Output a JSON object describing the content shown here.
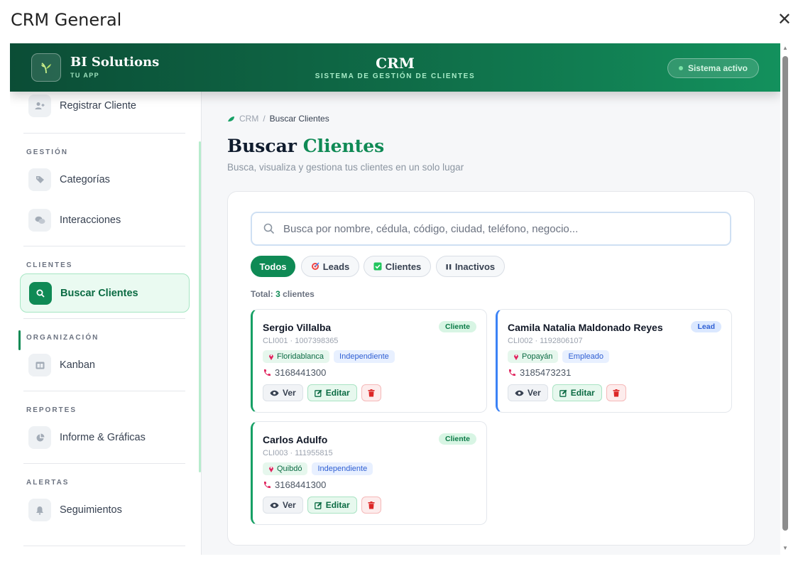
{
  "dialog": {
    "title": "CRM General",
    "close": "✕"
  },
  "header": {
    "brand_name": "BI Solutions",
    "brand_sub": "TU APP",
    "title": "CRM",
    "subtitle": "SISTEMA DE GESTIÓN DE CLIENTES",
    "status": "Sistema activo"
  },
  "sidebar": {
    "top_item": "Registrar Cliente",
    "sections": {
      "gestion": "GESTIÓN",
      "clientes": "CLIENTES",
      "organizacion": "ORGANIZACIÓN",
      "reportes": "REPORTES",
      "alertas": "ALERTAS"
    },
    "items": {
      "categorias": "Categorías",
      "interacciones": "Interacciones",
      "buscar": "Buscar Clientes",
      "kanban": "Kanban",
      "informe": "Informe & Gráficas",
      "seguimientos": "Seguimientos"
    }
  },
  "breadcrumb": {
    "root": "CRM",
    "sep": "/",
    "current": "Buscar Clientes"
  },
  "page": {
    "title_a": "Buscar",
    "title_b": "Clientes",
    "subtitle": "Busca, visualiza y gestiona tus clientes en un solo lugar"
  },
  "search": {
    "placeholder": "Busca por nombre, cédula, código, ciudad, teléfono, negocio..."
  },
  "filters": {
    "todos": "Todos",
    "leads": "Leads",
    "clientes": "Clientes",
    "inactivos": "Inactivos"
  },
  "total": {
    "prefix": "Total:",
    "count": "3",
    "suffix": "clientes"
  },
  "clients": [
    {
      "name": "Sergio Villalba",
      "badge": "Cliente",
      "code": "CLI001 · 1007398365",
      "city": "Floridablanca",
      "job": "Independiente",
      "phone": "3168441300"
    },
    {
      "name": "Camila Natalia Maldonado Reyes",
      "badge": "Lead",
      "code": "CLI002 · 1192806107",
      "city": "Popayán",
      "job": "Empleado",
      "phone": "3185473231"
    },
    {
      "name": "Carlos Adulfo",
      "badge": "Cliente",
      "code": "CLI003 · 111955815",
      "city": "Quibdó",
      "job": "Independiente",
      "phone": "3168441300"
    }
  ],
  "actions": {
    "ver": "Ver",
    "editar": "Editar"
  },
  "colors": {
    "brand": "#0f8a55",
    "header_dark": "#0b4d36",
    "lead": "#3b82f6",
    "danger": "#dc2626"
  }
}
